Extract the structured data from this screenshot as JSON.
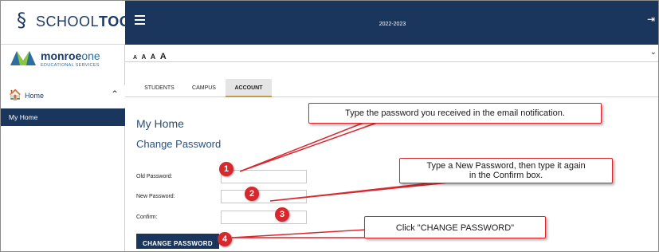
{
  "brand": {
    "app_name_light": "SCHOOL",
    "app_name_bold": "TOOL",
    "org_name_main": "monroe",
    "org_name_suffix": "one",
    "org_subtitle": "EDUCATIONAL SERVICES"
  },
  "topbar": {
    "school_year": "2022-2023"
  },
  "font_sizes": [
    "A",
    "A",
    "A",
    "A"
  ],
  "sidebar": {
    "items": [
      {
        "label": "Home",
        "icon": "home-icon",
        "expanded": true
      },
      {
        "label": "My Home",
        "selected": true
      }
    ]
  },
  "tabs": [
    {
      "label": "STUDENTS",
      "active": false
    },
    {
      "label": "CAMPUS",
      "active": false
    },
    {
      "label": "ACCOUNT",
      "active": true
    }
  ],
  "page": {
    "title": "My Home",
    "section": "Change Password"
  },
  "form": {
    "old_password_label": "Old Password:",
    "new_password_label": "New Password:",
    "confirm_label": "Confirm:",
    "old_password_value": "",
    "new_password_value": "",
    "confirm_value": "",
    "submit_label": "CHANGE PASSWORD"
  },
  "callouts": {
    "one": "Type the password you received in the email notification.",
    "two_line1": "Type a New Password, then type it again",
    "two_line2": "in the Confirm box.",
    "three": "Click \"CHANGE PASSWORD\""
  },
  "badges": [
    "1",
    "2",
    "3",
    "4"
  ],
  "colors": {
    "navy": "#1a365c",
    "callout_red": "#d9272e",
    "tab_underline": "#c59a4a",
    "heading_blue": "#2c4f7a"
  }
}
